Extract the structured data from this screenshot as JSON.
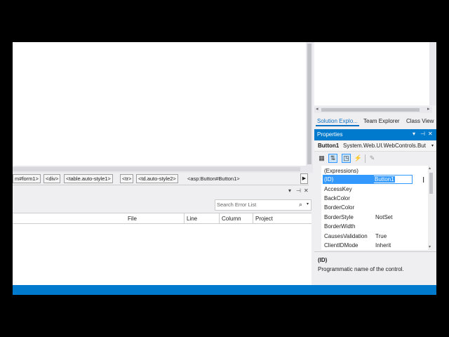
{
  "breadcrumb": {
    "items": [
      "m#form1>",
      "<div>",
      "<table.auto-style1>",
      "<tr>",
      "<td.auto-style2>",
      "<asp:Button#Button1>"
    ],
    "scroll_right": "▶"
  },
  "error_list": {
    "title_icons": [
      "▾",
      "⊣",
      "✕"
    ],
    "search_placeholder": "Search Error List",
    "search_icon": "⌕",
    "dropdown_icon": "▾",
    "columns": [
      "File",
      "Line",
      "Column",
      "Project"
    ]
  },
  "right_tabs": [
    "Solution Explo...",
    "Team Explorer",
    "Class View"
  ],
  "properties": {
    "title": "Properties",
    "title_buttons": [
      "▾",
      "⊣",
      "✕"
    ],
    "object_name": "Button1",
    "object_type": "System.Web.UI.WebControls.But",
    "object_dropdown": "▾",
    "toolbar_icons": [
      "▦",
      "⇅",
      "◳",
      "⚡",
      "✎"
    ],
    "rows": [
      {
        "name": "(Expressions)",
        "value": ""
      },
      {
        "name": "(ID)",
        "value": "Button1"
      },
      {
        "name": "AccessKey",
        "value": ""
      },
      {
        "name": "BackColor",
        "value": ""
      },
      {
        "name": "BorderColor",
        "value": ""
      },
      {
        "name": "BorderStyle",
        "value": "NotSet"
      },
      {
        "name": "BorderWidth",
        "value": ""
      },
      {
        "name": "CausesValidation",
        "value": "True"
      },
      {
        "name": "ClientIDMode",
        "value": "Inherit"
      }
    ],
    "desc_heading": "(ID)",
    "desc_text": "Programmatic name of the control."
  },
  "colors": {
    "accent": "#007acc",
    "selection": "#3399ff"
  }
}
